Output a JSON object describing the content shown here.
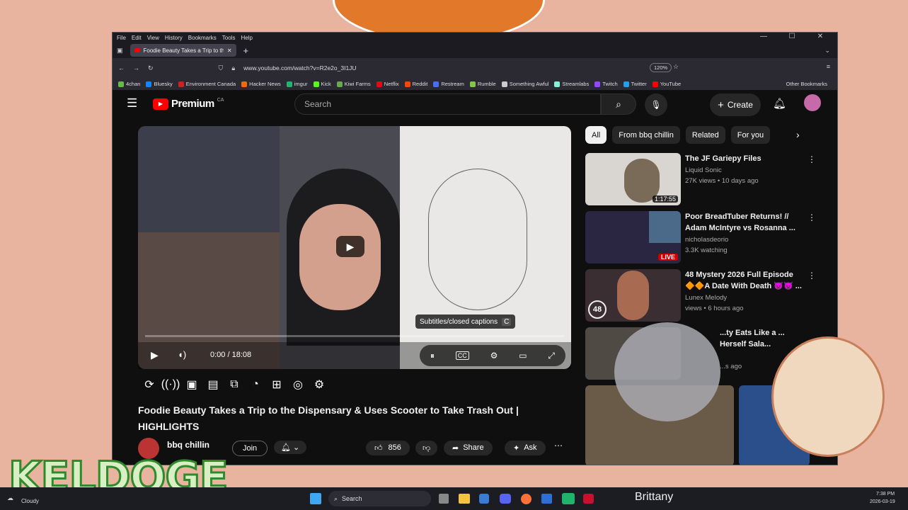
{
  "watermark": "KELDOGE",
  "browser": {
    "menu": [
      "File",
      "Edit",
      "View",
      "History",
      "Bookmarks",
      "Tools",
      "Help"
    ],
    "tab_title": "Foodie Beauty Takes a Trip to th",
    "url": "www.youtube.com/watch?v=R2e2o_3I1JU",
    "zoom": "120%",
    "bookmarks": [
      "4chan",
      "Bluesky",
      "Environment Canada",
      "Hacker News",
      "imgur",
      "Kick",
      "Kiwi Farms",
      "Netflix",
      "Reddit",
      "Restream",
      "Rumble",
      "Something Awful",
      "Streamlabs",
      "Twitch",
      "Twitter",
      "YouTube"
    ],
    "bookmark_colors": [
      "#66bb44",
      "#1185fe",
      "#cc2222",
      "#ff6600",
      "#1bb76e",
      "#53fc18",
      "#6aa84f",
      "#e50914",
      "#ff4500",
      "#4b6cf7",
      "#85c742",
      "#cccccc",
      "#80f5d2",
      "#9146ff",
      "#1da1f2",
      "#ff0000"
    ],
    "other_bookmarks": "Other Bookmarks"
  },
  "youtube": {
    "logo": "Premium",
    "region": "CA",
    "search_placeholder": "Search",
    "create_label": "Create",
    "player": {
      "time": "0:00 / 18:08",
      "tooltip": "Subtitles/closed captions",
      "tooltip_key": "C",
      "progress": 0.0
    },
    "video_title": "Foodie Beauty Takes a Trip to the Dispensary & Uses Scooter to Take Trash Out | HIGHLIGHTS",
    "channel": "bbq chillin",
    "join_label": "Join",
    "likes": "856",
    "share_label": "Share",
    "ask_label": "Ask",
    "chips": [
      "All",
      "From bbq chillin",
      "Related",
      "For you"
    ],
    "recs": [
      {
        "title": "The JF Gariepy Files",
        "channel": "Liquid Sonic",
        "meta": "27K views • 10 days ago",
        "duration": "1:17:55"
      },
      {
        "title": "Poor BreadTuber Returns! // Adam McIntyre vs Rosanna ...",
        "channel": "nicholasdeorio",
        "meta": "3.3K watching",
        "badge": "LIVE"
      },
      {
        "title": "48 Mystery 2026 Full Episode 🔶🔶A Date With Death 👿👿 ...",
        "channel": "Lunex Melody",
        "meta": "views • 6 hours ago",
        "badge": "48"
      },
      {
        "title": "...ty Eats Like a ... Herself Sala...",
        "channel": "",
        "meta": "...s ago"
      }
    ]
  },
  "taskbar": {
    "weather": "Cloudy",
    "search": "Search",
    "overlay_name": "Brittany",
    "time": "7:38 PM",
    "date": "2026-03-19"
  }
}
